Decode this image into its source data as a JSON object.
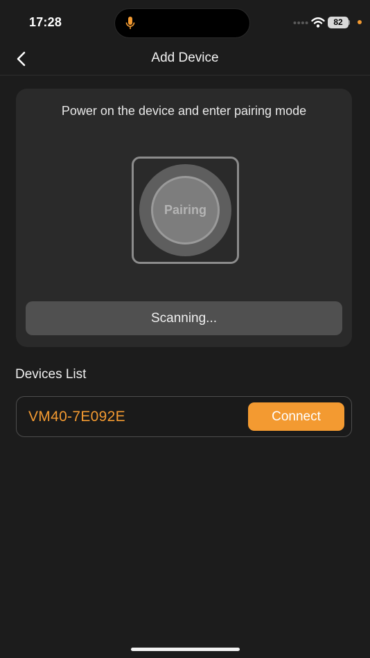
{
  "status_bar": {
    "time": "17:28",
    "battery": "82",
    "icons": [
      "microphone-icon",
      "signal-dots-icon",
      "wifi-icon",
      "battery-icon",
      "recording-dot"
    ],
    "accent_color": "#f39a31"
  },
  "nav": {
    "back_icon": "chevron-left-icon",
    "title": "Add Device"
  },
  "pairing": {
    "instruction": "Power on the device and enter pairing mode",
    "button_label": "Pairing",
    "scanning_label": "Scanning..."
  },
  "devices": {
    "heading": "Devices List",
    "items": [
      {
        "name": "VM40-7E092E",
        "action_label": "Connect"
      }
    ]
  },
  "colors": {
    "background": "#1c1c1c",
    "card": "#2a2a2a",
    "accent": "#f39a31"
  }
}
